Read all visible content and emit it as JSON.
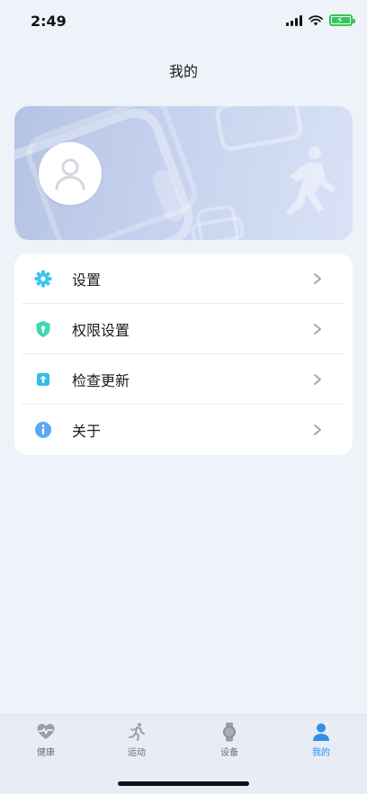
{
  "status_bar": {
    "time": "2:49"
  },
  "header": {
    "title": "我的"
  },
  "menu": {
    "items": [
      {
        "label": "设置",
        "icon": "gear-icon"
      },
      {
        "label": "权限设置",
        "icon": "shield-icon"
      },
      {
        "label": "检查更新",
        "icon": "update-icon"
      },
      {
        "label": "关于",
        "icon": "info-icon"
      }
    ]
  },
  "tab_bar": {
    "tabs": [
      {
        "label": "健康",
        "icon": "heart-icon"
      },
      {
        "label": "运动",
        "icon": "runner-icon"
      },
      {
        "label": "设备",
        "icon": "watch-icon"
      },
      {
        "label": "我的",
        "icon": "person-icon",
        "active": true
      }
    ]
  },
  "colors": {
    "accent": "#2f8ee8",
    "gear": "#3fc6ee",
    "shield": "#42d7b0",
    "update": "#2ec0e6",
    "info": "#5aa7f2"
  }
}
